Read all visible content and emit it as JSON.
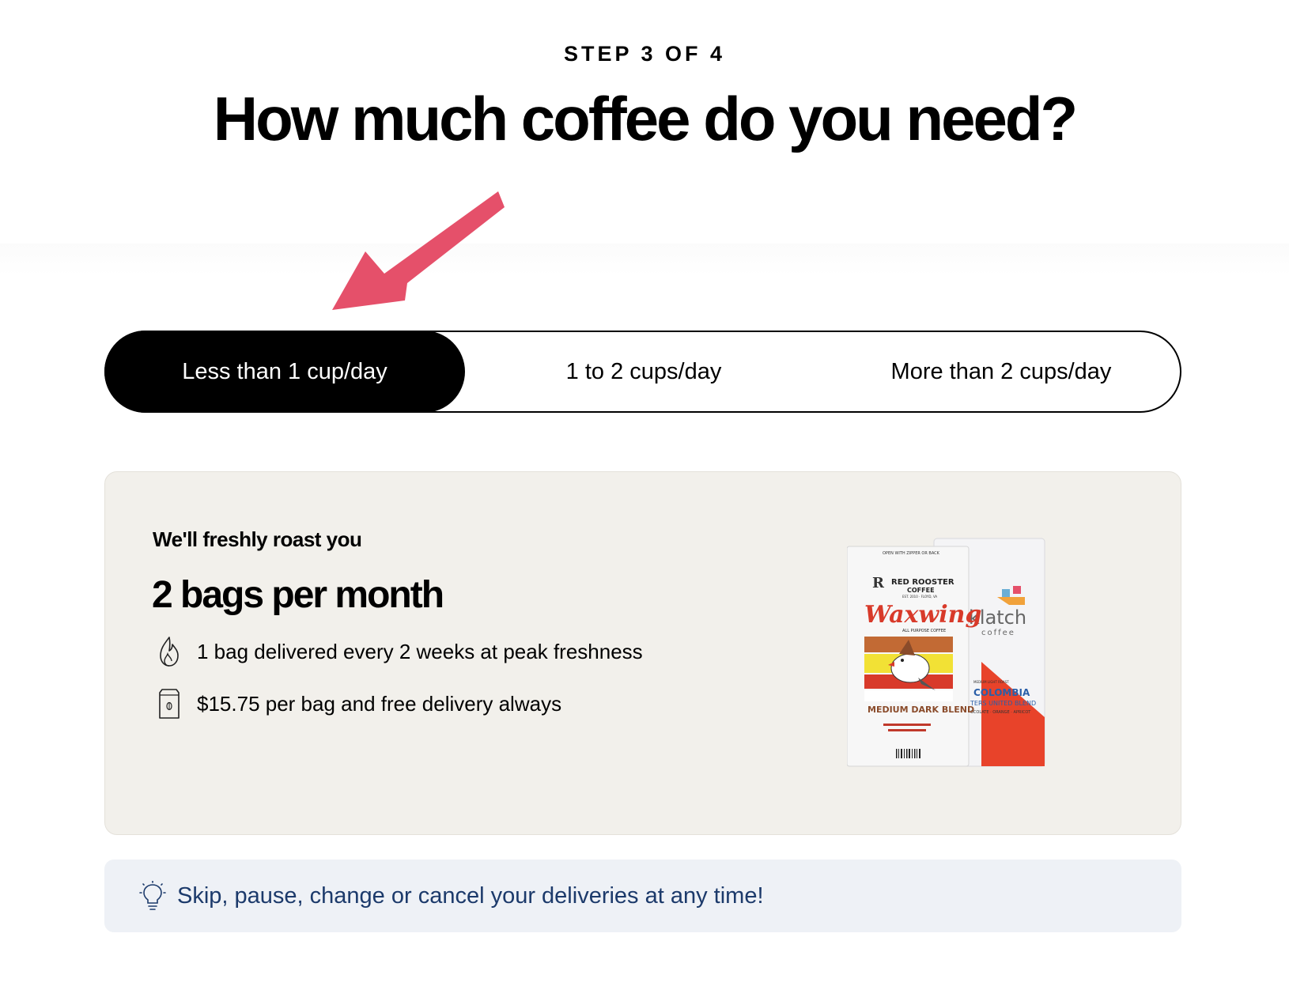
{
  "header": {
    "step_label": "STEP 3 OF 4",
    "title": "How much coffee do you need?"
  },
  "frequency": {
    "options": [
      {
        "label": "Less than 1 cup/day",
        "selected": true
      },
      {
        "label": "1 to 2 cups/day",
        "selected": false
      },
      {
        "label": "More than 2 cups/day",
        "selected": false
      }
    ]
  },
  "plan": {
    "intro": "We'll freshly roast you",
    "amount": "2 bags per month",
    "features": [
      {
        "icon": "flame-icon",
        "text": "1 bag delivered every 2 weeks at peak freshness"
      },
      {
        "icon": "coffee-bag-icon",
        "text": "$15.75 per bag and free delivery always"
      }
    ],
    "images": {
      "bag_front": {
        "brand_top": "OPEN WITH ZIPPER OR BACK",
        "brand": "RED ROOSTER",
        "brand_sub": "COFFEE",
        "est": "EST. 2010 · FLOYD, VA",
        "name": "Waxwing",
        "subtitle": "ALL PURPOSE COFFEE",
        "roast": "MEDIUM DARK BLEND"
      },
      "bag_back": {
        "brand": "klatch",
        "brand_sub": "coffee",
        "roast": "MEDIUM LIGHT ROAST",
        "origin": "COLOMBIA",
        "blend": "TERS UNITED BLEND",
        "notes": "OCOLATE · ORANGE · APRICOT"
      }
    }
  },
  "tip": {
    "icon": "lightbulb-icon",
    "text": "Skip, pause, change or cancel your deliveries at any time!"
  },
  "colors": {
    "accent_arrow": "#e5506a",
    "card_bg": "#f2f0eb",
    "tip_bg": "#eef1f6",
    "tip_text": "#1c3a6b"
  }
}
